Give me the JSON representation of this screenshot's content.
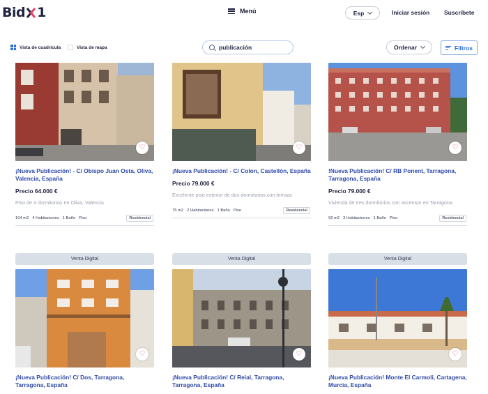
{
  "nav": {
    "logo": {
      "left": "Bid",
      "right": "1"
    },
    "menu_label": "Menú",
    "language": "Esp",
    "login": "Iniciar sesión",
    "signup": "Suscríbete"
  },
  "toolbar": {
    "grid_view": "Vista de cuadrícula",
    "map_view": "Vista de mapa",
    "search_value": "publicación",
    "order_label": "Ordenar",
    "filters_label": "Filtros"
  },
  "listings": [
    {
      "digital_badge": "",
      "title": "¡Nueva Publicación! - C/ Obispo Juan Osta, Oliva, Valencia, España",
      "price": "Precio 64.000 €",
      "description": "Piso de 4 dormitorios en Oliva, Valencia",
      "area": "104 m2",
      "rooms": "4 Habitaciones",
      "baths": "1 Baño",
      "kind": "Piso",
      "category": "Residencial"
    },
    {
      "digital_badge": "",
      "title": "¡Nueva Publicación! - C/ Colon, Castellón, España",
      "price": "Precio 79.000 €",
      "description": "Excelente piso exterior de dos dormitorios con terraza",
      "area": "75 m2",
      "rooms": "2 Habitaciones",
      "baths": "1 Baño",
      "kind": "Piso",
      "category": "Residencial"
    },
    {
      "digital_badge": "",
      "title": "!Nueva Publicación! C/ RB Ponent, Tarragona, Tarragona, España",
      "price": "Precio 79.000 €",
      "description": "Vivienda de tres dormitorios con ascensor en Tarragona",
      "area": "92 m2",
      "rooms": "3 Habitaciones",
      "baths": "1 Baño",
      "kind": "Piso",
      "category": "Residencial"
    },
    {
      "digital_badge": "Venta Digital",
      "title": "¡Nueva Publicación! C/ Dos, Tarragona, Tarragona, España"
    },
    {
      "digital_badge": "Venta Digital",
      "title": "¡Nueva Publicación! C/ Reial, Tarragona, Tarragona, España"
    },
    {
      "digital_badge": "Venta Digital",
      "title": "¡Nueva Publicación! Monte El Carmoli, Cartagena, Murcia, España"
    }
  ],
  "colors": {
    "brand_navy": "#1f2340",
    "link_blue": "#2f4aa8",
    "accent_blue": "#2b6ed6",
    "heart": "#e0436a"
  },
  "icons": {
    "menu": "hamburger-icon",
    "search": "search-icon",
    "filters": "filter-icon",
    "favorite": "heart-icon"
  },
  "heart_glyph": "♡"
}
